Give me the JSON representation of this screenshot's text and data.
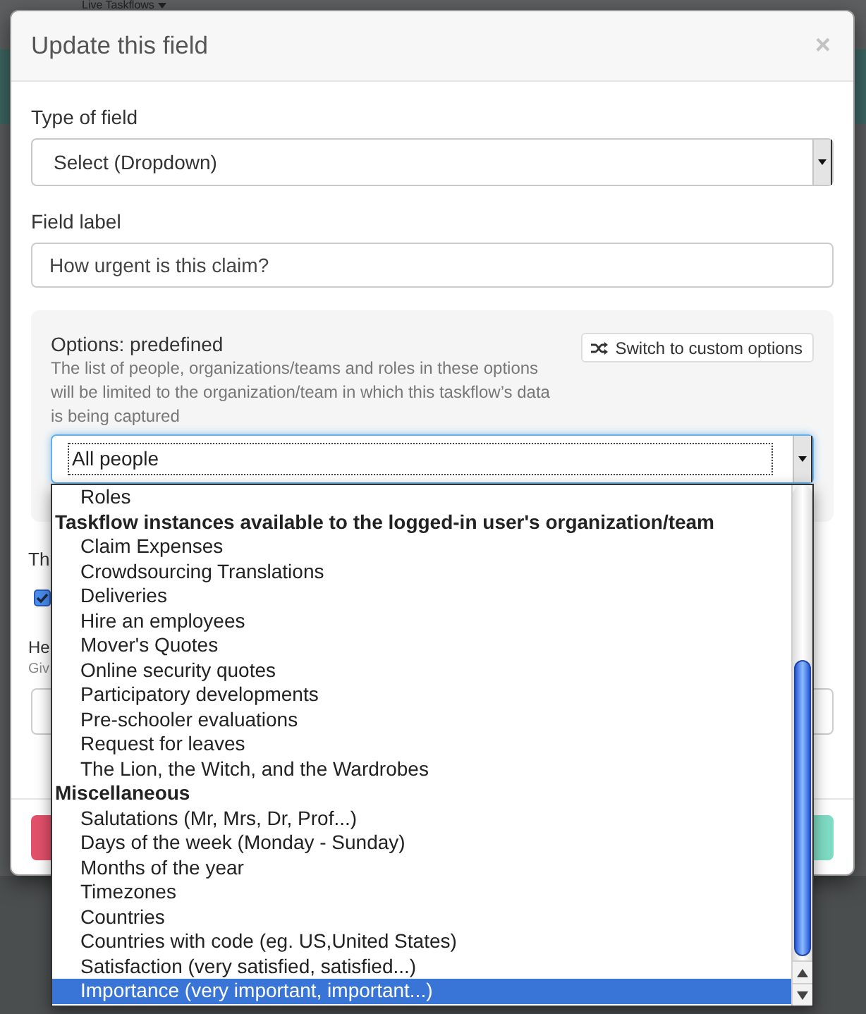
{
  "background": {
    "menu_title": "Live Taskflows"
  },
  "modal": {
    "title": "Update this field",
    "close": "×"
  },
  "type_of_field": {
    "label": "Type of field",
    "value": "Select (Dropdown)"
  },
  "field_label": {
    "label": "Field label",
    "value": "How urgent is this claim?"
  },
  "options_panel": {
    "heading": "Options: predefined",
    "help": "The list of people, organizations/teams and roles in these options will be limited to the organization/team in which this taskflow’s data is being captured",
    "switch_button": "Switch to custom options",
    "select": {
      "value": "All people",
      "expanded": true,
      "options": [
        {
          "kind": "option",
          "label": "Roles",
          "selected": false
        },
        {
          "kind": "group",
          "label": "Taskflow instances available to the logged-in user's organization/team",
          "children": [
            {
              "kind": "option",
              "label": "Claim Expenses",
              "selected": false
            },
            {
              "kind": "option",
              "label": "Crowdsourcing Translations",
              "selected": false
            },
            {
              "kind": "option",
              "label": "Deliveries",
              "selected": false
            },
            {
              "kind": "option",
              "label": "Hire an employees",
              "selected": false
            },
            {
              "kind": "option",
              "label": "Mover's Quotes",
              "selected": false
            },
            {
              "kind": "option",
              "label": "Online security quotes",
              "selected": false
            },
            {
              "kind": "option",
              "label": "Participatory developments",
              "selected": false
            },
            {
              "kind": "option",
              "label": "Pre-schooler evaluations",
              "selected": false
            },
            {
              "kind": "option",
              "label": "Request for leaves",
              "selected": false
            },
            {
              "kind": "option",
              "label": "The Lion, the Witch, and the Wardrobes",
              "selected": false
            }
          ]
        },
        {
          "kind": "group",
          "label": "Miscellaneous",
          "children": [
            {
              "kind": "option",
              "label": "Salutations (Mr, Mrs, Dr, Prof...)",
              "selected": false
            },
            {
              "kind": "option",
              "label": "Days of the week (Monday - Sunday)",
              "selected": false
            },
            {
              "kind": "option",
              "label": "Months of the year",
              "selected": false
            },
            {
              "kind": "option",
              "label": "Timezones",
              "selected": false
            },
            {
              "kind": "option",
              "label": "Countries",
              "selected": false
            },
            {
              "kind": "option",
              "label": "Countries with code (eg. US,United States)",
              "selected": false
            },
            {
              "kind": "option",
              "label": "Satisfaction (very satisfied, satisfied...)",
              "selected": false
            },
            {
              "kind": "option",
              "label": "Importance (very important, important...)",
              "selected": true
            }
          ]
        }
      ]
    }
  },
  "covered_fields": {
    "label_1": "Th",
    "checkbox": {
      "checked": true
    },
    "label_2": "He",
    "hint": "Giv"
  }
}
